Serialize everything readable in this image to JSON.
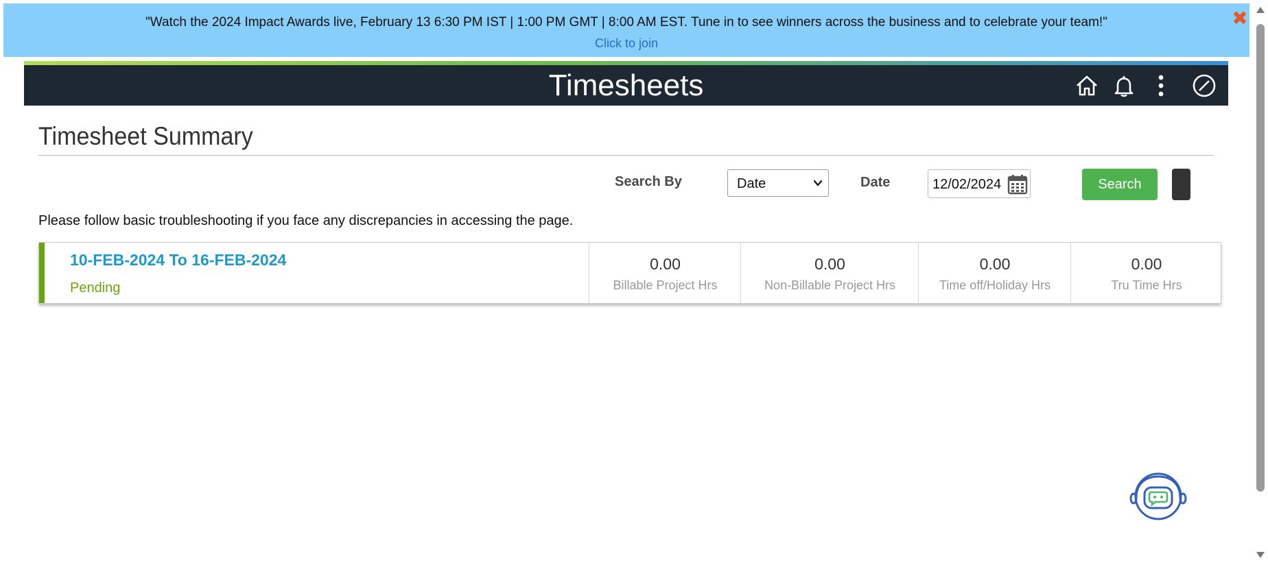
{
  "banner": {
    "message": "\"Watch the 2024 Impact Awards live, February 13 6:30 PM IST | 1:00 PM GMT | 8:00 AM EST. Tune in to see winners across the business and to celebrate your team!\"",
    "link_label": "Click to join",
    "close_symbol": "✖",
    "background": "#87cefa"
  },
  "header": {
    "title": "Timesheets",
    "icons": [
      "home-icon",
      "bell-icon",
      "more-vertical-icon",
      "compass-icon"
    ],
    "background": "#1e2833"
  },
  "page": {
    "title": "Timesheet Summary"
  },
  "search": {
    "search_by_label": "Search By",
    "search_by_value": "Date",
    "date_label": "Date",
    "date_value": "12/02/2024",
    "button_label": "Search",
    "button_color": "#4fb251"
  },
  "notice": "Please follow basic troubleshooting if you face any discrepancies in accessing the page.",
  "summary": {
    "period": "10-FEB-2024 To 16-FEB-2024",
    "status": "Pending",
    "status_color": "#6aa510",
    "metrics": [
      {
        "value": "0.00",
        "label": "Billable Project Hrs"
      },
      {
        "value": "0.00",
        "label": "Non-Billable Project Hrs"
      },
      {
        "value": "0.00",
        "label": "Time off/Holiday Hrs"
      },
      {
        "value": "0.00",
        "label": "Tru Time Hrs"
      }
    ]
  },
  "chatbot": {
    "icon": "chatbot-icon"
  }
}
